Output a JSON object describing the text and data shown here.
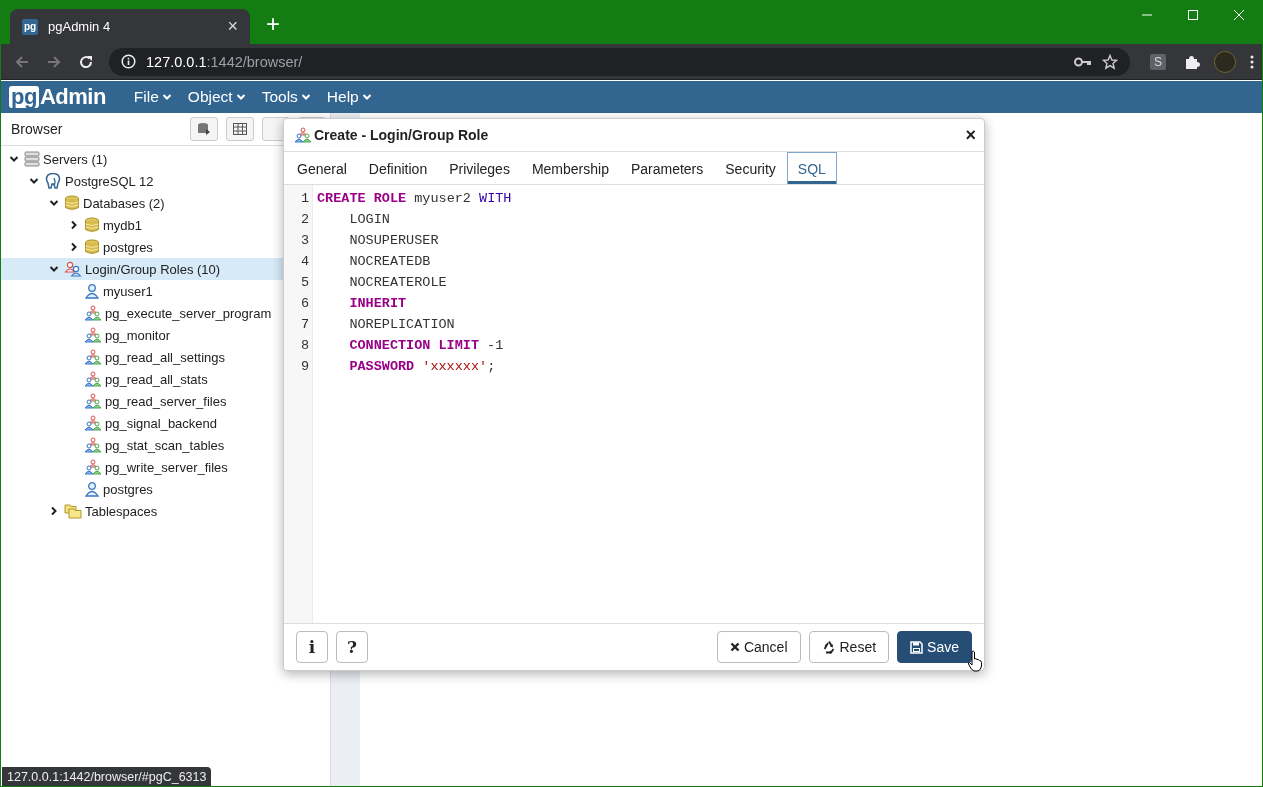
{
  "browser_tab": {
    "favicon": "pg",
    "title": "pgAdmin 4",
    "close": "×",
    "new_tab": "+"
  },
  "address_bar": {
    "host": "127.0.0.1",
    "path": ":1442/browser/"
  },
  "extension_badge": "S",
  "app": {
    "logo_badge": "pg",
    "logo_text": "Admin",
    "menus": [
      "File",
      "Object",
      "Tools",
      "Help"
    ]
  },
  "browser_panel": {
    "title": "Browser",
    "tree": [
      {
        "label": "Servers (1)",
        "kind": "servers",
        "expandable": true,
        "expanded": true,
        "selected": false,
        "children": [
          {
            "label": "PostgreSQL 12",
            "kind": "server",
            "expandable": true,
            "expanded": true,
            "selected": false,
            "children": [
              {
                "label": "Databases (2)",
                "kind": "databases",
                "expandable": true,
                "expanded": true,
                "selected": false,
                "children": [
                  {
                    "label": "mydb1",
                    "kind": "database",
                    "expandable": true,
                    "expanded": false,
                    "selected": false
                  },
                  {
                    "label": "postgres",
                    "kind": "database",
                    "expandable": true,
                    "expanded": false,
                    "selected": false
                  }
                ]
              },
              {
                "label": "Login/Group Roles (10)",
                "kind": "roles",
                "expandable": true,
                "expanded": true,
                "selected": true,
                "children": [
                  {
                    "label": "myuser1",
                    "kind": "user",
                    "expandable": false,
                    "selected": false
                  },
                  {
                    "label": "pg_execute_server_program",
                    "kind": "group",
                    "expandable": false,
                    "selected": false
                  },
                  {
                    "label": "pg_monitor",
                    "kind": "group",
                    "expandable": false,
                    "selected": false
                  },
                  {
                    "label": "pg_read_all_settings",
                    "kind": "group",
                    "expandable": false,
                    "selected": false
                  },
                  {
                    "label": "pg_read_all_stats",
                    "kind": "group",
                    "expandable": false,
                    "selected": false
                  },
                  {
                    "label": "pg_read_server_files",
                    "kind": "group",
                    "expandable": false,
                    "selected": false
                  },
                  {
                    "label": "pg_signal_backend",
                    "kind": "group",
                    "expandable": false,
                    "selected": false
                  },
                  {
                    "label": "pg_stat_scan_tables",
                    "kind": "group",
                    "expandable": false,
                    "selected": false
                  },
                  {
                    "label": "pg_write_server_files",
                    "kind": "group",
                    "expandable": false,
                    "selected": false
                  },
                  {
                    "label": "postgres",
                    "kind": "user",
                    "expandable": false,
                    "selected": false
                  }
                ]
              },
              {
                "label": "Tablespaces",
                "kind": "tablespaces",
                "expandable": true,
                "expanded": false,
                "selected": false
              }
            ]
          }
        ]
      }
    ]
  },
  "dialog": {
    "title": "Create - Login/Group Role",
    "close": "×",
    "tabs": [
      {
        "label": "General",
        "selected": false
      },
      {
        "label": "Definition",
        "selected": false
      },
      {
        "label": "Privileges",
        "selected": false
      },
      {
        "label": "Membership",
        "selected": false
      },
      {
        "label": "Parameters",
        "selected": false
      },
      {
        "label": "Security",
        "selected": false
      },
      {
        "label": "SQL",
        "selected": true
      }
    ],
    "sql_lines": [
      {
        "number": "1",
        "indented": false,
        "segments": [
          {
            "kind": "keyword",
            "text": "CREATE ROLE"
          },
          {
            "kind": "plain",
            "text": " myuser2 "
          },
          {
            "kind": "builtin",
            "text": "WITH"
          }
        ]
      },
      {
        "number": "2",
        "indented": true,
        "segments": [
          {
            "kind": "plain",
            "text": "LOGIN"
          }
        ]
      },
      {
        "number": "3",
        "indented": true,
        "segments": [
          {
            "kind": "plain",
            "text": "NOSUPERUSER"
          }
        ]
      },
      {
        "number": "4",
        "indented": true,
        "segments": [
          {
            "kind": "plain",
            "text": "NOCREATEDB"
          }
        ]
      },
      {
        "number": "5",
        "indented": true,
        "segments": [
          {
            "kind": "plain",
            "text": "NOCREATEROLE"
          }
        ]
      },
      {
        "number": "6",
        "indented": true,
        "segments": [
          {
            "kind": "keyword",
            "text": "INHERIT"
          }
        ]
      },
      {
        "number": "7",
        "indented": true,
        "segments": [
          {
            "kind": "plain",
            "text": "NOREPLICATION"
          }
        ]
      },
      {
        "number": "8",
        "indented": true,
        "segments": [
          {
            "kind": "keyword",
            "text": "CONNECTION LIMIT"
          },
          {
            "kind": "plain",
            "text": " -1"
          }
        ]
      },
      {
        "number": "9",
        "indented": true,
        "segments": [
          {
            "kind": "keyword",
            "text": "PASSWORD"
          },
          {
            "kind": "string",
            "text": " 'xxxxxx'"
          },
          {
            "kind": "plain",
            "text": ";"
          }
        ]
      }
    ],
    "info_button": "i",
    "help_button": "?",
    "actions": [
      {
        "kind": "cancel",
        "label": "Cancel"
      },
      {
        "kind": "reset",
        "label": "Reset"
      },
      {
        "kind": "save",
        "label": "Save"
      }
    ]
  },
  "status_url": "127.0.0.1:1442/browser/#pgC_6313"
}
